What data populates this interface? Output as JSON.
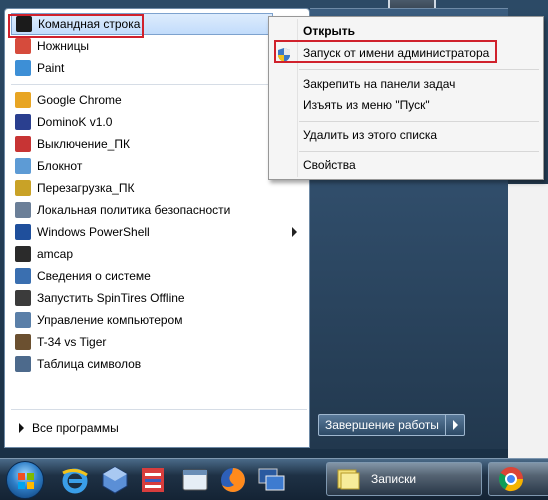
{
  "start_menu": {
    "programs": [
      {
        "label": "Командная строка",
        "icon": "cmd-icon",
        "color": "#1b1b1b"
      },
      {
        "label": "Ножницы",
        "icon": "scissors-icon",
        "color": "#d64b3c"
      },
      {
        "label": "Paint",
        "icon": "paint-icon",
        "color": "#3d8fd6"
      },
      {
        "label": "Google Chrome",
        "icon": "chrome-icon",
        "color": "#e8a523"
      },
      {
        "label": "DominoK v1.0",
        "icon": "domino-icon",
        "color": "#2a3f8f"
      },
      {
        "label": "Выключение_ПК",
        "icon": "shutdown-app-icon",
        "color": "#c73434"
      },
      {
        "label": "Блокнот",
        "icon": "notepad-icon",
        "color": "#5d9bd5"
      },
      {
        "label": "Перезагрузка_ПК",
        "icon": "restart-app-icon",
        "color": "#c9a227"
      },
      {
        "label": "Локальная политика безопасности",
        "icon": "security-policy-icon",
        "color": "#6b7f98"
      },
      {
        "label": "Windows PowerShell",
        "icon": "powershell-icon",
        "color": "#1f4f9c"
      },
      {
        "label": "amcap",
        "icon": "camera-icon",
        "color": "#2b2b2b"
      },
      {
        "label": "Сведения о системе",
        "icon": "system-info-icon",
        "color": "#3a6fb0"
      },
      {
        "label": "Запустить SpinTires Offline",
        "icon": "spintires-icon",
        "color": "#3b3b3b"
      },
      {
        "label": "Управление компьютером",
        "icon": "computer-management-icon",
        "color": "#5a7fa8"
      },
      {
        "label": "T-34 vs Tiger",
        "icon": "tank-game-icon",
        "color": "#6b5030"
      },
      {
        "label": "Таблица символов",
        "icon": "charmap-icon",
        "color": "#4d6a8c"
      }
    ],
    "all_programs": "Все программы",
    "shutdown": "Завершение работы"
  },
  "context_menu": {
    "items": [
      "Открыть",
      "Запуск от имени администратора",
      "Закрепить на панели задач",
      "Изъять из меню \"Пуск\"",
      "Удалить из этого списка",
      "Свойства"
    ]
  },
  "taskbar": {
    "notes_label": "Записки",
    "pinned": [
      "ie-icon",
      "virtualbox-icon",
      "archiver-icon",
      "window-icon",
      "firefox-icon",
      "remote-desktop-icon"
    ]
  },
  "colors": {
    "highlight_border": "#d0212c",
    "selection": "#c2dcfb"
  }
}
